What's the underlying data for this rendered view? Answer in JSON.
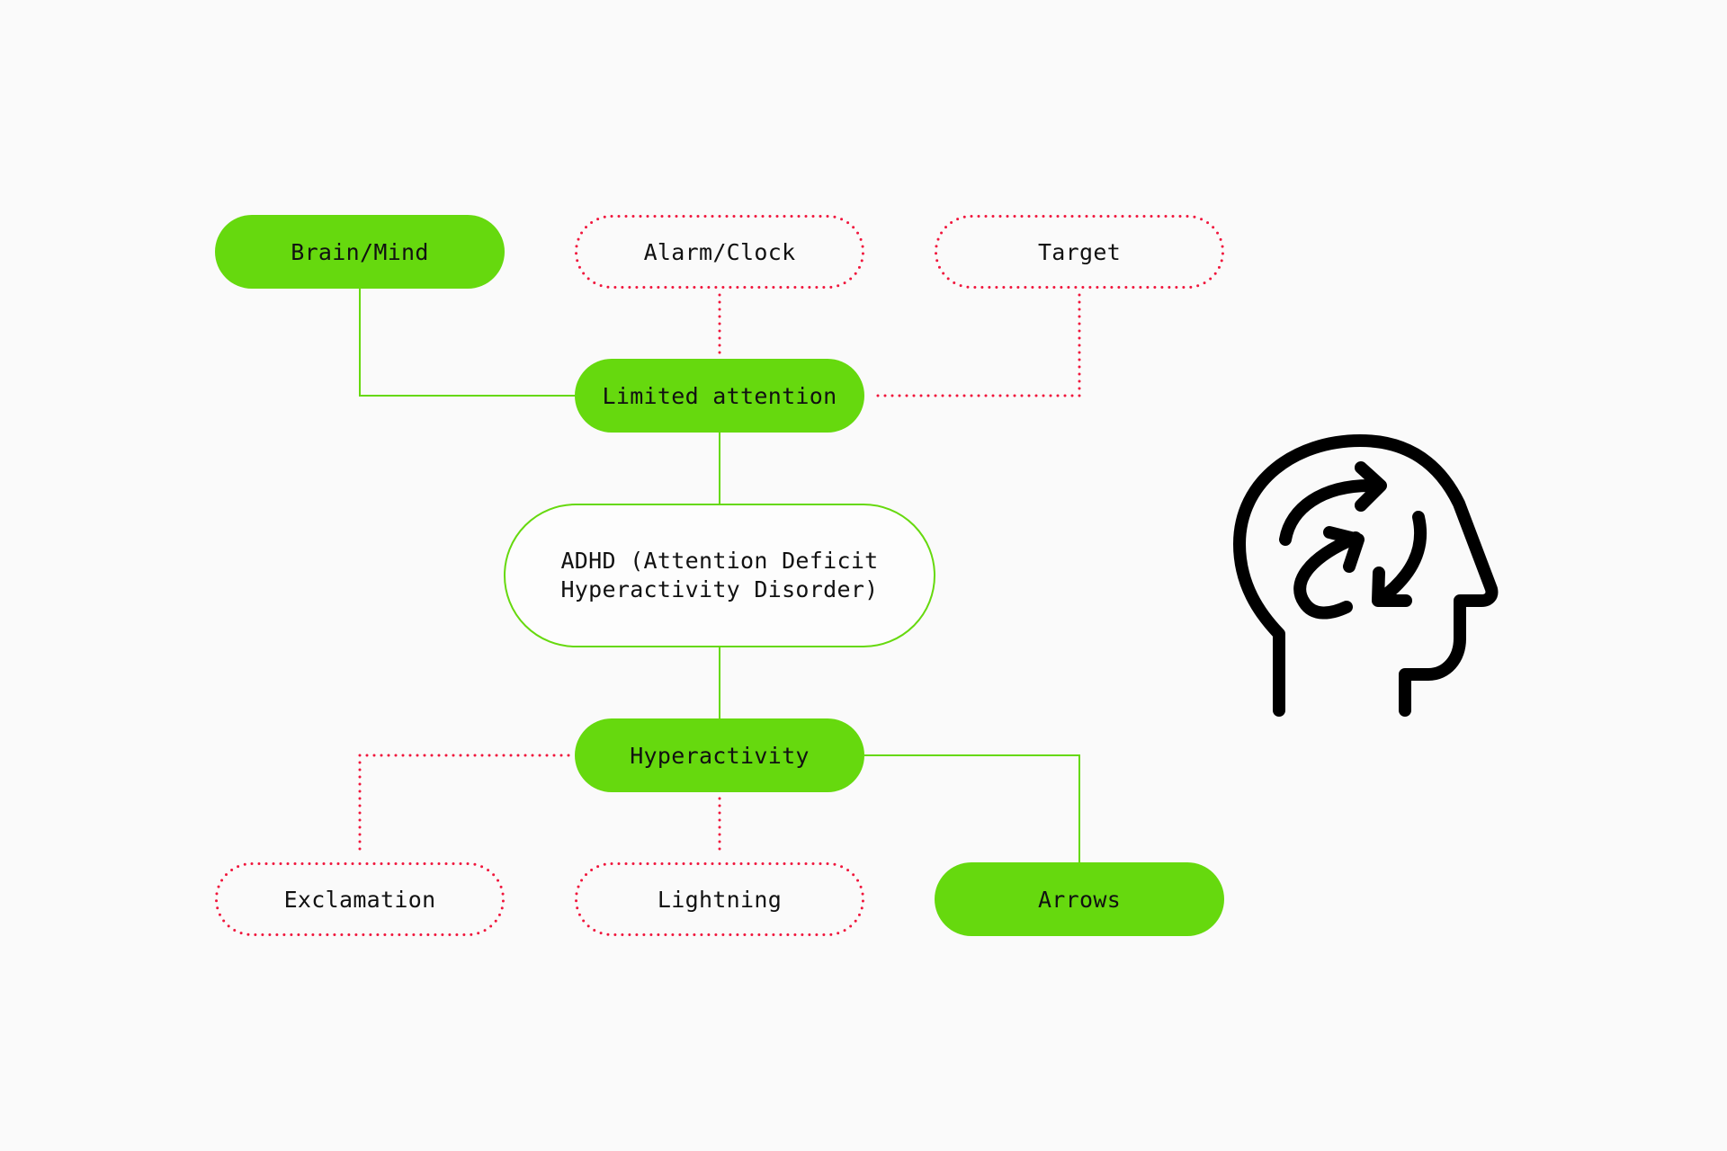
{
  "diagram": {
    "title": "",
    "colors": {
      "background": "#fafafa",
      "accent_green": "#66d90e",
      "dotted_red": "#f0163c",
      "text": "#111111"
    },
    "nodes": {
      "brain": {
        "label": "Brain/Mind",
        "style": "filled"
      },
      "alarm": {
        "label": "Alarm/Clock",
        "style": "dotted"
      },
      "target": {
        "label": "Target",
        "style": "dotted"
      },
      "limited": {
        "label": "Limited attention",
        "style": "filled"
      },
      "adhd": {
        "label_line1": "ADHD (Attention Deficit",
        "label_line2": "Hyperactivity Disorder)",
        "style": "outlined"
      },
      "hyper": {
        "label": "Hyperactivity",
        "style": "filled"
      },
      "excl": {
        "label": "Exclamation",
        "style": "dotted"
      },
      "light": {
        "label": "Lightning",
        "style": "dotted"
      },
      "arrows": {
        "label": "Arrows",
        "style": "filled"
      }
    },
    "edges": [
      {
        "from": "brain",
        "to": "limited",
        "style": "solid"
      },
      {
        "from": "alarm",
        "to": "limited",
        "style": "dotted"
      },
      {
        "from": "target",
        "to": "limited",
        "style": "dotted"
      },
      {
        "from": "limited",
        "to": "adhd",
        "style": "solid"
      },
      {
        "from": "adhd",
        "to": "hyper",
        "style": "solid"
      },
      {
        "from": "hyper",
        "to": "excl",
        "style": "dotted"
      },
      {
        "from": "hyper",
        "to": "light",
        "style": "dotted"
      },
      {
        "from": "hyper",
        "to": "arrows",
        "style": "solid"
      }
    ],
    "illustration": {
      "icon": "head-with-circular-arrows-icon"
    }
  }
}
